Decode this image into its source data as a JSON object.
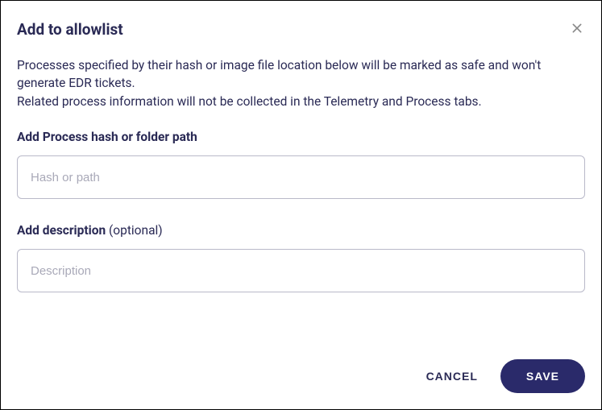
{
  "dialog": {
    "title": "Add to allowlist",
    "description_line1": "Processes specified by their hash or image file location below will be marked as safe and won't generate EDR tickets.",
    "description_line2": "Related process information will not be collected in the Telemetry and Process tabs."
  },
  "fields": {
    "hash": {
      "label": "Add Process hash or folder path",
      "placeholder": "Hash or path",
      "value": ""
    },
    "description": {
      "label_strong": "Add description",
      "label_optional": " (optional)",
      "placeholder": "Description",
      "value": ""
    }
  },
  "actions": {
    "cancel": "CANCEL",
    "save": "SAVE"
  },
  "colors": {
    "text_primary": "#2a2a55",
    "border_input": "#b9b9c9",
    "button_primary_bg": "#2a2a6a"
  }
}
